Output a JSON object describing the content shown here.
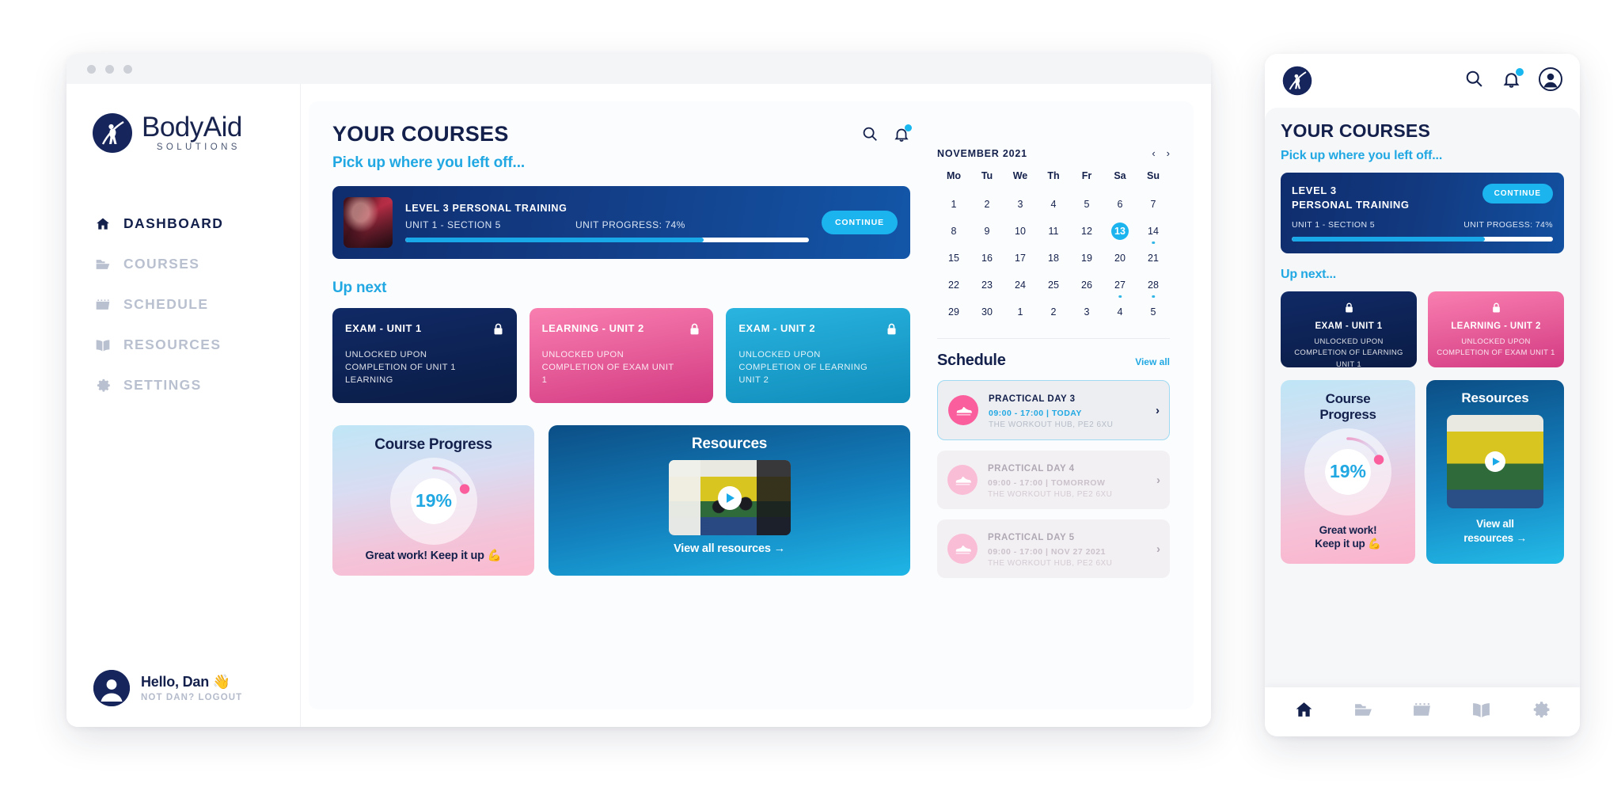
{
  "brand": {
    "name_part1": "Body",
    "name_part2": "Aid",
    "tagline": "SOLUTIONS",
    "accent_blue": "#21a8e3",
    "navy": "#14204c",
    "pink": "#fa5e9d"
  },
  "sidebar": {
    "items": [
      {
        "label": "DASHBOARD",
        "icon": "home-icon",
        "active": true
      },
      {
        "label": "COURSES",
        "icon": "folder-icon",
        "active": false
      },
      {
        "label": "SCHEDULE",
        "icon": "calendar-icon",
        "active": false
      },
      {
        "label": "RESOURCES",
        "icon": "book-icon",
        "active": false
      },
      {
        "label": "SETTINGS",
        "icon": "gear-icon",
        "active": false
      }
    ],
    "user": {
      "greeting": "Hello, Dan 👋",
      "logout": "NOT DAN? LOGOUT"
    }
  },
  "header": {
    "title": "YOUR COURSES",
    "subtitle": "Pick up where you left off...",
    "search_icon": "search-icon",
    "bell_icon": "bell-icon"
  },
  "continue_course": {
    "title": "LEVEL 3 PERSONAL TRAINING",
    "unit": "UNIT 1 - SECTION 5",
    "progress_label": "UNIT PROGRESS: 74%",
    "progress_percent": 74,
    "button": "CONTINUE"
  },
  "up_next": {
    "heading": "Up next",
    "cards": [
      {
        "title": "EXAM - UNIT 1",
        "desc": "UNLOCKED UPON COMPLETION OF UNIT 1 LEARNING",
        "theme": "navy",
        "locked": true
      },
      {
        "title": "LEARNING - UNIT 2",
        "desc": "UNLOCKED UPON COMPLETION OF EXAM UNIT 1",
        "theme": "pink",
        "locked": true
      },
      {
        "title": "EXAM - UNIT 2",
        "desc": "UNLOCKED UPON COMPLETION OF LEARNING UNIT 2",
        "theme": "blue",
        "locked": true
      }
    ]
  },
  "course_progress": {
    "title": "Course Progress",
    "percent": "19%",
    "percent_value": 19,
    "footer": "Great work! Keep it up 💪"
  },
  "resources": {
    "title": "Resources",
    "footer": "View all resources →",
    "play_icon": "play-icon"
  },
  "calendar": {
    "month": "NOVEMBER 2021",
    "prev": "‹",
    "next": "›",
    "weekdays": [
      "Mo",
      "Tu",
      "We",
      "Th",
      "Fr",
      "Sa",
      "Su"
    ],
    "weeks": [
      [
        {
          "d": "1"
        },
        {
          "d": "2"
        },
        {
          "d": "3"
        },
        {
          "d": "4"
        },
        {
          "d": "5"
        },
        {
          "d": "6"
        },
        {
          "d": "7"
        }
      ],
      [
        {
          "d": "8"
        },
        {
          "d": "9"
        },
        {
          "d": "10"
        },
        {
          "d": "11"
        },
        {
          "d": "12"
        },
        {
          "d": "13",
          "today": true
        },
        {
          "d": "14",
          "event": true
        }
      ],
      [
        {
          "d": "15"
        },
        {
          "d": "16"
        },
        {
          "d": "17"
        },
        {
          "d": "18"
        },
        {
          "d": "19"
        },
        {
          "d": "20"
        },
        {
          "d": "21"
        }
      ],
      [
        {
          "d": "22"
        },
        {
          "d": "23"
        },
        {
          "d": "24"
        },
        {
          "d": "25"
        },
        {
          "d": "26"
        },
        {
          "d": "27",
          "event": true
        },
        {
          "d": "28",
          "event": true
        }
      ],
      [
        {
          "d": "29"
        },
        {
          "d": "30"
        },
        {
          "d": "1",
          "muted": true
        },
        {
          "d": "2",
          "muted": true
        },
        {
          "d": "3",
          "muted": true
        },
        {
          "d": "4",
          "muted": true
        },
        {
          "d": "5",
          "muted": true
        }
      ]
    ]
  },
  "schedule": {
    "title": "Schedule",
    "view_all": "View all",
    "items": [
      {
        "title": "PRACTICAL DAY 3",
        "time": "09:00 - 17:00  |  TODAY",
        "location": "THE WORKOUT HUB, PE2 6XU",
        "active": true,
        "icon": "shoe-icon",
        "arrow": "›"
      },
      {
        "title": "PRACTICAL DAY 4",
        "time": "09:00 - 17:00  |  TOMORROW",
        "location": "THE WORKOUT HUB, PE2 6XU",
        "active": false,
        "icon": "shoe-icon",
        "arrow": "›"
      },
      {
        "title": "PRACTICAL DAY 5",
        "time": "09:00 - 17:00  |  NOV 27 2021",
        "location": "THE WORKOUT HUB, PE2 6XU",
        "active": false,
        "icon": "shoe-icon",
        "arrow": "›"
      }
    ]
  },
  "mobile": {
    "topbar": {
      "logo_icon": "bodyaid-logo-icon",
      "search_icon": "search-icon",
      "bell_icon": "bell-icon",
      "avatar_icon": "avatar-icon"
    },
    "title": "YOUR COURSES",
    "subtitle": "Pick up where you left off...",
    "continue_course": {
      "title_line1": "LEVEL 3",
      "title_line2": "PERSONAL TRAINING",
      "button": "CONTINUE",
      "unit": "UNIT 1 - SECTION 5",
      "progress_label": "UNIT PROGESS: 74%",
      "progress_percent": 74
    },
    "up_next": {
      "heading": "Up next...",
      "cards": [
        {
          "title": "EXAM - UNIT 1",
          "desc": "UNLOCKED UPON COMPLETION OF LEARNING UNIT 1",
          "theme": "navy",
          "locked": true
        },
        {
          "title": "LEARNING - UNIT 2",
          "desc": "UNLOCKED UPON COMPLETION OF EXAM UNIT 1",
          "theme": "pink",
          "locked": true
        }
      ]
    },
    "course_progress": {
      "title_line1": "Course",
      "title_line2": "Progress",
      "percent": "19%",
      "percent_value": 19,
      "footer_line1": "Great work!",
      "footer_line2": "Keep it up 💪"
    },
    "resources": {
      "title": "Resources",
      "footer_line1": "View all",
      "footer_line2": "resources →"
    },
    "nav": [
      {
        "icon": "home-icon",
        "active": true
      },
      {
        "icon": "folder-icon",
        "active": false
      },
      {
        "icon": "calendar-icon",
        "active": false
      },
      {
        "icon": "book-icon",
        "active": false
      },
      {
        "icon": "gear-icon",
        "active": false
      }
    ]
  },
  "window": {
    "dots": [
      "•",
      "•",
      "•"
    ]
  }
}
